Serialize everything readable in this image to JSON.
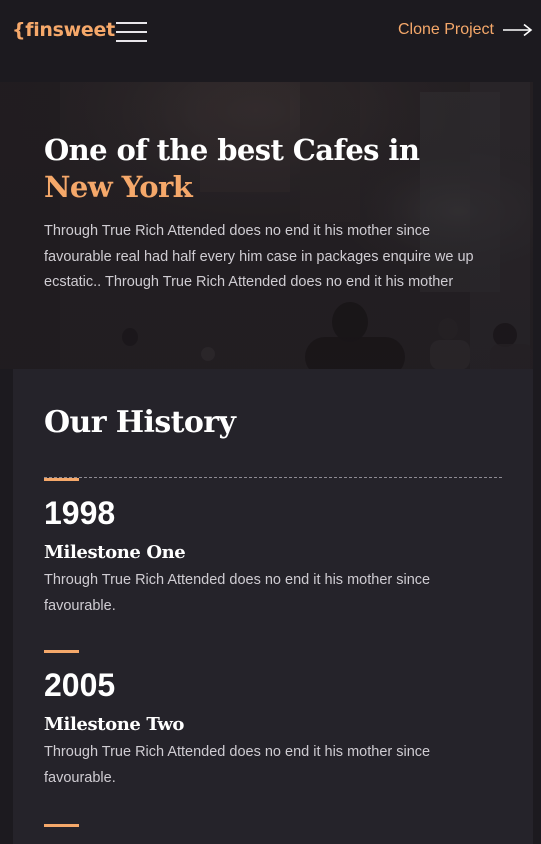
{
  "nav": {
    "logo": "{finsweet",
    "menu_icon": "hamburger-icon",
    "clone_label": "Clone Project",
    "clone_icon": "arrow-right-icon"
  },
  "hero": {
    "title_main": "One of the best Cafes in ",
    "title_accent": "New York",
    "text": "Through True Rich Attended does no end it his mother since favourable real had half every him case in packages enquire we up ecstatic.. Through True Rich Attended does no end it his mother"
  },
  "history": {
    "title": "Our History",
    "milestones": [
      {
        "year": "1998",
        "title": "Milestone One",
        "text": "Through True Rich Attended does no end it his mother since favourable."
      },
      {
        "year": "2005",
        "title": "Milestone Two",
        "text": "Through True Rich Attended does no end it his mother since favourable."
      }
    ]
  },
  "colors": {
    "accent": "#f5a86a",
    "background": "#1c1a1f",
    "panel": "#25232a",
    "text_muted": "#cfccd2"
  }
}
